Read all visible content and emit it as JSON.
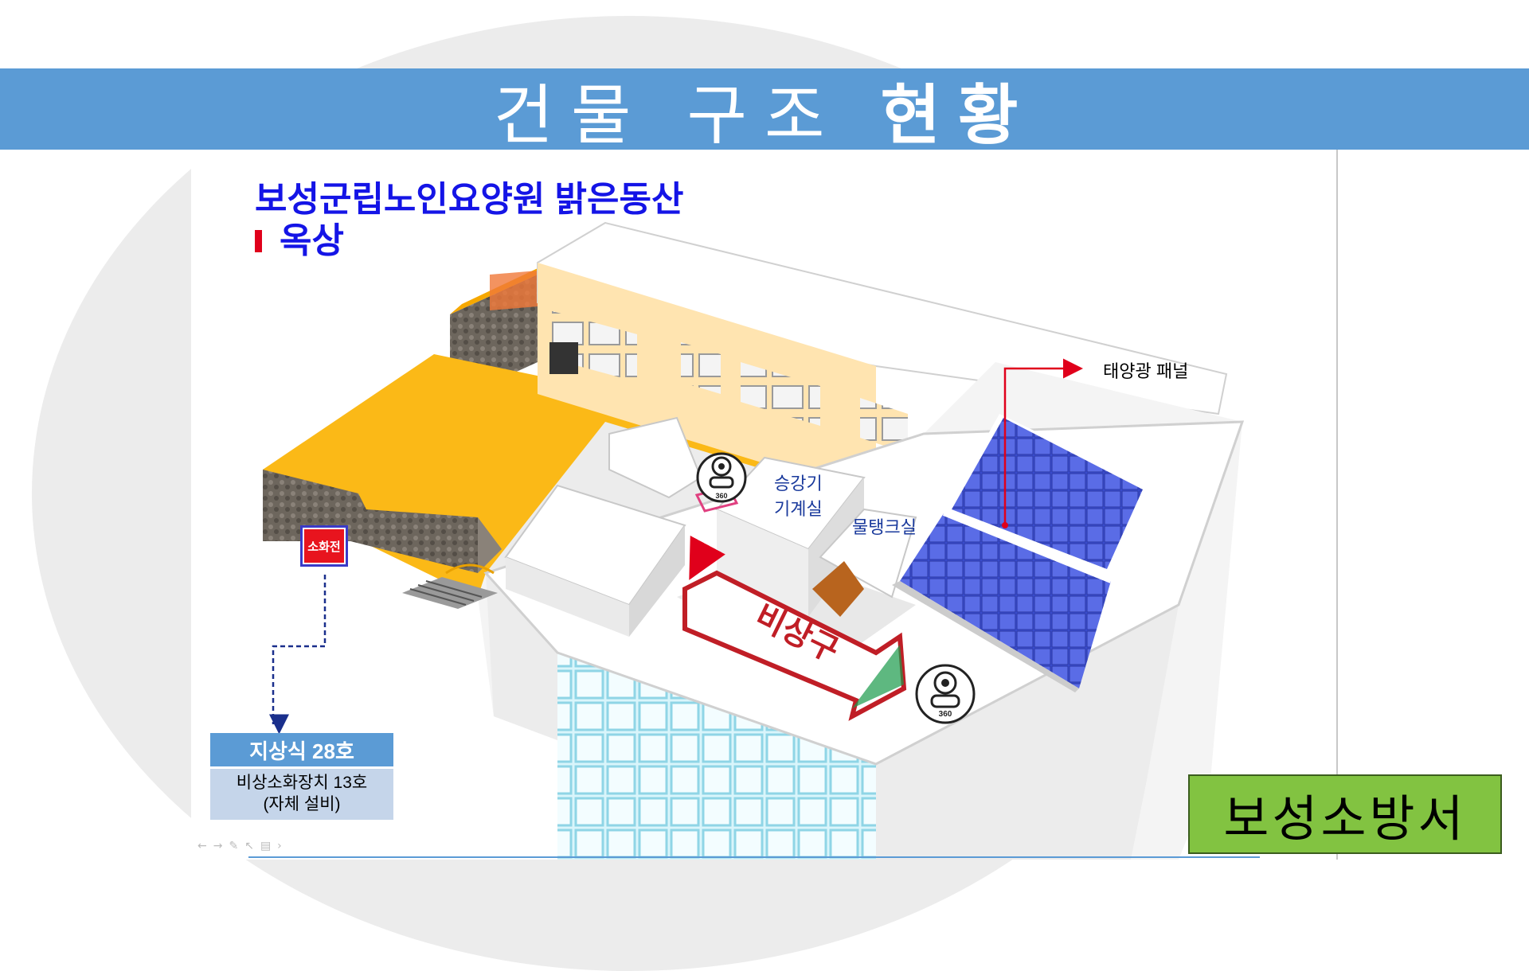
{
  "slide": {
    "title_light": "건물 구조 ",
    "title_bold": "현황",
    "facility_name": "보성군립노인요양원 밝은동산",
    "floor_name": "옥상",
    "footer_org": "보성소방서"
  },
  "labels": {
    "solar_panel": "태양광 패널",
    "elevator_room_line1": "승강기",
    "elevator_room_line2": "기계실",
    "water_tank_room": "물탱크실",
    "hydrant_tag": "소화전",
    "camera_badge": "360",
    "evac_sign": "비상구"
  },
  "hydrant_info": {
    "header": "지상식 28호",
    "line1": "비상소화장치 13호",
    "line2": "(자체 설비)"
  },
  "colors": {
    "title_bar": "#5b9bd5",
    "facility_text": "#1414e6",
    "floor_marker": "#e0001b",
    "footer_bg": "#82c341",
    "roof_orange": "#fbb917",
    "solar_blue": "#3e52d8"
  }
}
